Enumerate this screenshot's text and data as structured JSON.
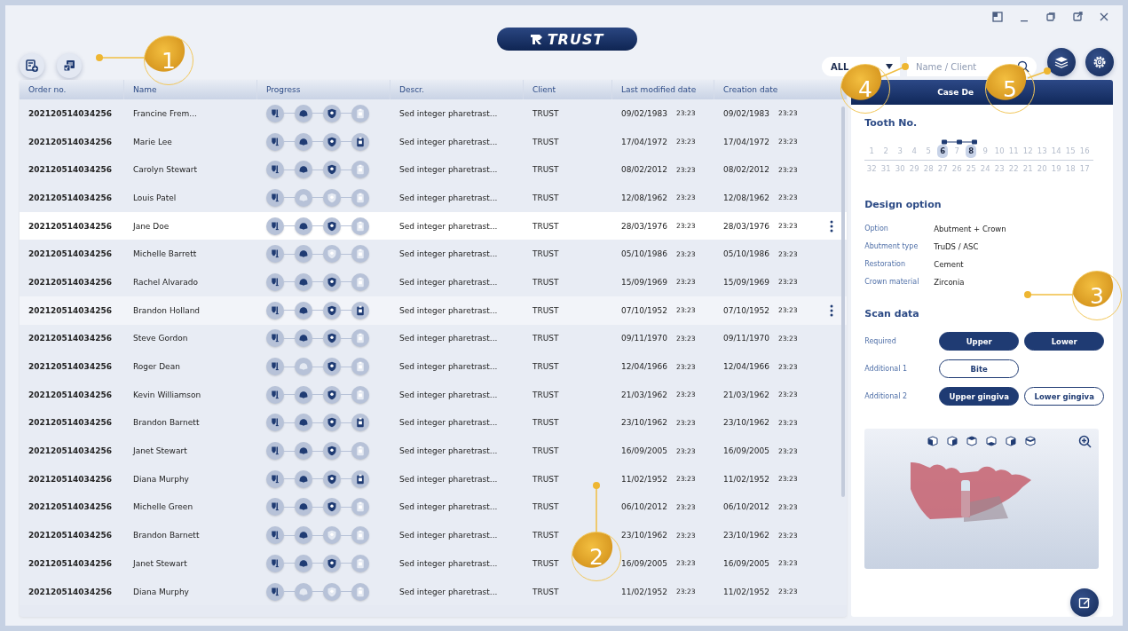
{
  "logo": {
    "text": "TRUST"
  },
  "filter": {
    "value": "ALL"
  },
  "search": {
    "placeholder": "Name / Client"
  },
  "table": {
    "columns": [
      "Order no.",
      "Name",
      "Progress",
      "Descr.",
      "Client",
      "Last modified date",
      "Creation date"
    ],
    "rows": [
      {
        "order": "202120514034256",
        "name": "Francine Frem...",
        "steps": [
          true,
          true,
          true,
          false
        ],
        "descr": "Sed integer pharetrast...",
        "client": "TRUST",
        "modified_date": "09/02/1983",
        "modified_time": "23:23",
        "created_date": "09/02/1983",
        "created_time": "23:23",
        "selected": false,
        "hovered": false
      },
      {
        "order": "202120514034256",
        "name": "Marie Lee",
        "steps": [
          true,
          true,
          true,
          true
        ],
        "descr": "Sed integer pharetrast...",
        "client": "TRUST",
        "modified_date": "17/04/1972",
        "modified_time": "23:23",
        "created_date": "17/04/1972",
        "created_time": "23:23",
        "selected": false,
        "hovered": false
      },
      {
        "order": "202120514034256",
        "name": "Carolyn Stewart",
        "steps": [
          true,
          true,
          true,
          false
        ],
        "descr": "Sed integer pharetrast...",
        "client": "TRUST",
        "modified_date": "08/02/2012",
        "modified_time": "23:23",
        "created_date": "08/02/2012",
        "created_time": "23:23",
        "selected": false,
        "hovered": false
      },
      {
        "order": "202120514034256",
        "name": "Louis Patel",
        "steps": [
          true,
          false,
          false,
          false
        ],
        "descr": "Sed integer pharetrast...",
        "client": "TRUST",
        "modified_date": "12/08/1962",
        "modified_time": "23:23",
        "created_date": "12/08/1962",
        "created_time": "23:23",
        "selected": false,
        "hovered": false
      },
      {
        "order": "202120514034256",
        "name": "Jane Doe",
        "steps": [
          true,
          true,
          true,
          false
        ],
        "descr": "Sed integer pharetrast...",
        "client": "TRUST",
        "modified_date": "28/03/1976",
        "modified_time": "23:23",
        "created_date": "28/03/1976",
        "created_time": "23:23",
        "selected": true,
        "hovered": false
      },
      {
        "order": "202120514034256",
        "name": "Michelle Barrett",
        "steps": [
          true,
          true,
          false,
          false
        ],
        "descr": "Sed integer pharetrast...",
        "client": "TRUST",
        "modified_date": "05/10/1986",
        "modified_time": "23:23",
        "created_date": "05/10/1986",
        "created_time": "23:23",
        "selected": false,
        "hovered": false
      },
      {
        "order": "202120514034256",
        "name": "Rachel Alvarado",
        "steps": [
          true,
          true,
          true,
          false
        ],
        "descr": "Sed integer pharetrast...",
        "client": "TRUST",
        "modified_date": "15/09/1969",
        "modified_time": "23:23",
        "created_date": "15/09/1969",
        "created_time": "23:23",
        "selected": false,
        "hovered": false
      },
      {
        "order": "202120514034256",
        "name": "Brandon Holland",
        "steps": [
          true,
          true,
          true,
          true
        ],
        "descr": "Sed integer pharetrast...",
        "client": "TRUST",
        "modified_date": "07/10/1952",
        "modified_time": "23:23",
        "created_date": "07/10/1952",
        "created_time": "23:23",
        "selected": false,
        "hovered": true
      },
      {
        "order": "202120514034256",
        "name": "Steve Gordon",
        "steps": [
          true,
          true,
          true,
          false
        ],
        "descr": "Sed integer pharetrast...",
        "client": "TRUST",
        "modified_date": "09/11/1970",
        "modified_time": "23:23",
        "created_date": "09/11/1970",
        "created_time": "23:23",
        "selected": false,
        "hovered": false
      },
      {
        "order": "202120514034256",
        "name": "Roger Dean",
        "steps": [
          true,
          false,
          true,
          false
        ],
        "descr": "Sed integer pharetrast...",
        "client": "TRUST",
        "modified_date": "12/04/1966",
        "modified_time": "23:23",
        "created_date": "12/04/1966",
        "created_time": "23:23",
        "selected": false,
        "hovered": false
      },
      {
        "order": "202120514034256",
        "name": "Kevin Williamson",
        "steps": [
          true,
          true,
          true,
          false
        ],
        "descr": "Sed integer pharetrast...",
        "client": "TRUST",
        "modified_date": "21/03/1962",
        "modified_time": "23:23",
        "created_date": "21/03/1962",
        "created_time": "23:23",
        "selected": false,
        "hovered": false
      },
      {
        "order": "202120514034256",
        "name": "Brandon Barnett",
        "steps": [
          true,
          true,
          true,
          true
        ],
        "descr": "Sed integer pharetrast...",
        "client": "TRUST",
        "modified_date": "23/10/1962",
        "modified_time": "23:23",
        "created_date": "23/10/1962",
        "created_time": "23:23",
        "selected": false,
        "hovered": false
      },
      {
        "order": "202120514034256",
        "name": "Janet Stewart",
        "steps": [
          true,
          true,
          true,
          false
        ],
        "descr": "Sed integer pharetrast...",
        "client": "TRUST",
        "modified_date": "16/09/2005",
        "modified_time": "23:23",
        "created_date": "16/09/2005",
        "created_time": "23:23",
        "selected": false,
        "hovered": false
      },
      {
        "order": "202120514034256",
        "name": "Diana Murphy",
        "steps": [
          true,
          true,
          true,
          true
        ],
        "descr": "Sed integer pharetrast...",
        "client": "TRUST",
        "modified_date": "11/02/1952",
        "modified_time": "23:23",
        "created_date": "11/02/1952",
        "created_time": "23:23",
        "selected": false,
        "hovered": false
      },
      {
        "order": "202120514034256",
        "name": "Michelle Green",
        "steps": [
          true,
          true,
          true,
          false
        ],
        "descr": "Sed integer pharetrast...",
        "client": "TRUST",
        "modified_date": "06/10/2012",
        "modified_time": "23:23",
        "created_date": "06/10/2012",
        "created_time": "23:23",
        "selected": false,
        "hovered": false
      },
      {
        "order": "202120514034256",
        "name": "Brandon Barnett",
        "steps": [
          true,
          true,
          false,
          false
        ],
        "descr": "Sed integer pharetrast...",
        "client": "TRUST",
        "modified_date": "23/10/1962",
        "modified_time": "23:23",
        "created_date": "23/10/1962",
        "created_time": "23:23",
        "selected": false,
        "hovered": false
      },
      {
        "order": "202120514034256",
        "name": "Janet Stewart",
        "steps": [
          true,
          true,
          true,
          false
        ],
        "descr": "Sed integer pharetrast...",
        "client": "TRUST",
        "modified_date": "16/09/2005",
        "modified_time": "23:23",
        "created_date": "16/09/2005",
        "created_time": "23:23",
        "selected": false,
        "hovered": false
      },
      {
        "order": "202120514034256",
        "name": "Diana Murphy",
        "steps": [
          true,
          false,
          false,
          false
        ],
        "descr": "Sed integer pharetrast...",
        "client": "TRUST",
        "modified_date": "11/02/1952",
        "modified_time": "23:23",
        "created_date": "11/02/1952",
        "created_time": "23:23",
        "selected": false,
        "hovered": false
      }
    ]
  },
  "case_panel": {
    "title": "Case De",
    "tooth_heading": "Tooth No.",
    "upper_teeth": [
      {
        "label": "1",
        "selected": false
      },
      {
        "label": "2",
        "selected": false
      },
      {
        "label": "3",
        "selected": false
      },
      {
        "label": "4",
        "selected": false
      },
      {
        "label": "5",
        "selected": false
      },
      {
        "label": "6",
        "selected": true
      },
      {
        "label": "7",
        "selected": false
      },
      {
        "label": "8",
        "selected": true
      },
      {
        "label": "9",
        "selected": false
      },
      {
        "label": "10",
        "selected": false
      },
      {
        "label": "11",
        "selected": false
      },
      {
        "label": "12",
        "selected": false
      },
      {
        "label": "13",
        "selected": false
      },
      {
        "label": "14",
        "selected": false
      },
      {
        "label": "15",
        "selected": false
      },
      {
        "label": "16",
        "selected": false
      }
    ],
    "lower_teeth": [
      {
        "label": "32",
        "selected": false
      },
      {
        "label": "31",
        "selected": false
      },
      {
        "label": "30",
        "selected": false
      },
      {
        "label": "29",
        "selected": false
      },
      {
        "label": "28",
        "selected": false
      },
      {
        "label": "27",
        "selected": false
      },
      {
        "label": "26",
        "selected": false
      },
      {
        "label": "25",
        "selected": false
      },
      {
        "label": "24",
        "selected": false
      },
      {
        "label": "23",
        "selected": false
      },
      {
        "label": "22",
        "selected": false
      },
      {
        "label": "21",
        "selected": false
      },
      {
        "label": "20",
        "selected": false
      },
      {
        "label": "19",
        "selected": false
      },
      {
        "label": "18",
        "selected": false
      },
      {
        "label": "17",
        "selected": false
      }
    ],
    "design_heading": "Design option",
    "design": [
      {
        "label": "Option",
        "value": "Abutment + Crown"
      },
      {
        "label": "Abutment type",
        "value": "TruDS / ASC"
      },
      {
        "label": "Restoration",
        "value": "Cement"
      },
      {
        "label": "Crown material",
        "value": "Zirconia"
      }
    ],
    "scan_heading": "Scan data",
    "scan": [
      {
        "label": "Required",
        "buttons": [
          {
            "label": "Upper",
            "selected": true
          },
          {
            "label": "Lower",
            "selected": true
          }
        ]
      },
      {
        "label": "Additional 1",
        "buttons": [
          {
            "label": "Bite",
            "selected": false
          }
        ]
      },
      {
        "label": "Additional 2",
        "buttons": [
          {
            "label": "Upper gingiva",
            "selected": true
          },
          {
            "label": "Lower gingiva",
            "selected": false
          }
        ]
      }
    ]
  },
  "callouts": [
    {
      "label": "1"
    },
    {
      "label": "2"
    },
    {
      "label": "3"
    },
    {
      "label": "4"
    },
    {
      "label": "5"
    }
  ]
}
